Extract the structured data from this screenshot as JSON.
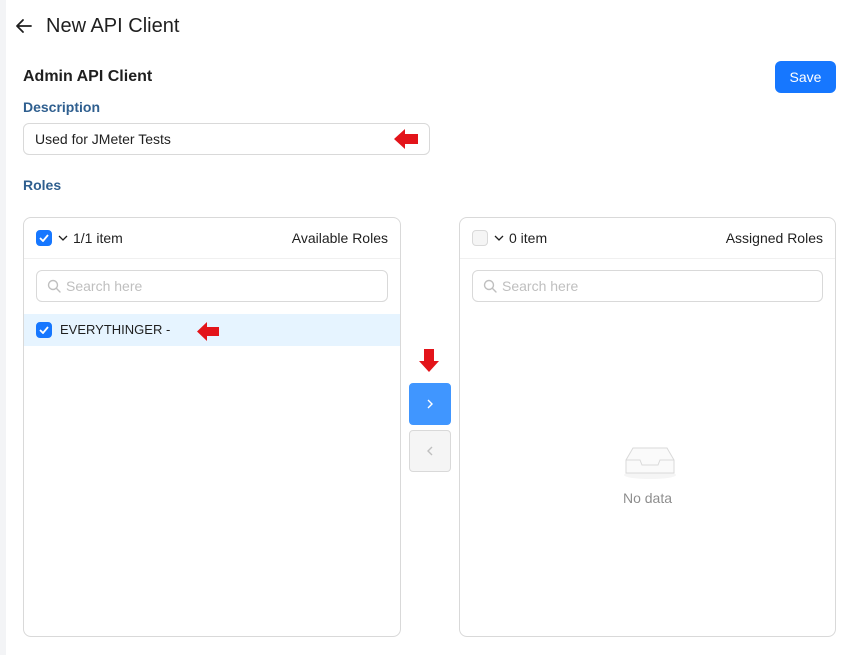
{
  "header": {
    "title": "New API Client",
    "back_icon": "arrow-left-icon"
  },
  "client": {
    "name": "Admin API Client"
  },
  "actions": {
    "save_label": "Save"
  },
  "description": {
    "label": "Description",
    "value": "Used for JMeter Tests"
  },
  "roles": {
    "label": "Roles",
    "available": {
      "title": "Available Roles",
      "count_text": "1/1 item",
      "all_checked": true,
      "search_placeholder": "Search here",
      "items": [
        {
          "label": "EVERYTHINGER -",
          "checked": true
        }
      ]
    },
    "assigned": {
      "title": "Assigned Roles",
      "count_text": "0 item",
      "all_checked": false,
      "search_placeholder": "Search here",
      "items": [],
      "empty_text": "No data"
    },
    "move_right_icon": "chevron-right-icon",
    "move_left_icon": "chevron-left-icon"
  },
  "annotations": {
    "arrow_color": "#e3141a"
  },
  "colors": {
    "primary": "#1677ff",
    "label": "#2f5f8f",
    "selected_row": "#e6f4ff"
  }
}
